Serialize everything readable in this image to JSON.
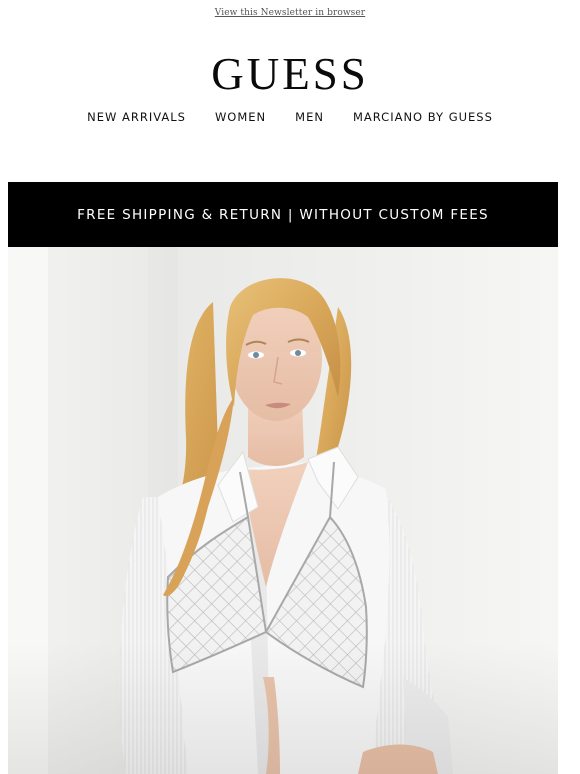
{
  "header": {
    "view_in_browser": "View this Newsletter in browser",
    "logo": "GUESS"
  },
  "nav": {
    "items": [
      {
        "label": "NEW ARRIVALS"
      },
      {
        "label": "WOMEN"
      },
      {
        "label": "MEN"
      },
      {
        "label": "MARCIANO BY GUESS"
      }
    ]
  },
  "banner": {
    "text": "FREE SHIPPING & RETURN | WITHOUT CUSTOM FEES",
    "background": "#000000",
    "color": "#ffffff"
  },
  "hero": {
    "image": "model-white-shirt-crystal-bralette-photo"
  }
}
